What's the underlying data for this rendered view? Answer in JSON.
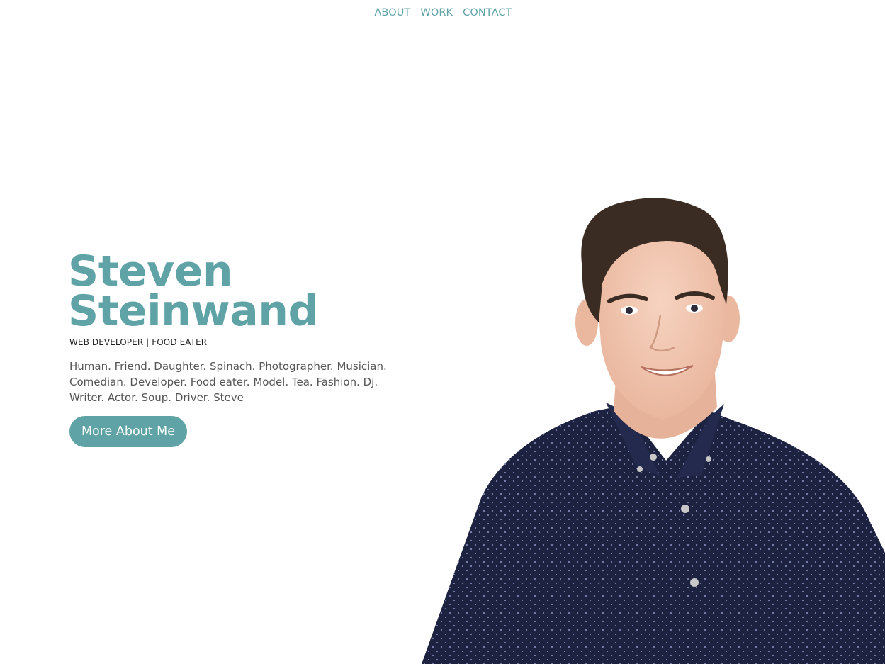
{
  "nav": {
    "items": [
      {
        "label": "ABOUT"
      },
      {
        "label": "WORK"
      },
      {
        "label": "CONTACT"
      }
    ]
  },
  "hero": {
    "first_name": "Steven",
    "last_name": "Steinwand",
    "tagline": "WEB DEVELOPER | FOOD EATER",
    "bio": "Human. Friend. Daughter. Spinach. Photographer. Musician. Comedian. Developer. Food eater. Model. Tea. Fashion. Dj. Writer. Actor. Soup. Driver. Steve",
    "cta_label": "More About Me"
  },
  "colors": {
    "accent": "#5fa3a6",
    "text_dark": "#1f1f1f",
    "text_body": "#555555",
    "shirt": "#1c2240",
    "hair": "#3a2c22",
    "skin": "#f2c6b0"
  }
}
